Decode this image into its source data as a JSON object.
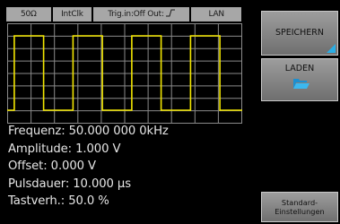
{
  "status_bar": {
    "impedance": "50Ω",
    "clock": "IntClk",
    "trigger": "Trig.in:Off Out:",
    "trigger_edge": "rising",
    "interface": "LAN"
  },
  "waveform": {
    "type": "pulse",
    "visible_cycles": 4,
    "color": "#f2e600"
  },
  "parameters": [
    {
      "label": "Frequenz:",
      "value": "50.000 000 0kHz"
    },
    {
      "label": "Amplitude:",
      "value": "1.000 V"
    },
    {
      "label": "Offset:",
      "value": "0.000 V"
    },
    {
      "label": "Pulsdauer:",
      "value": "10.000 µs"
    },
    {
      "label": "Tastverh.:",
      "value": "50.0 %"
    }
  ],
  "softkeys": {
    "save": "SPEICHERN",
    "load": "LADEN",
    "defaults_line1": "Standard-",
    "defaults_line2": "Einstellungen"
  },
  "colors": {
    "accent": "#29aee6",
    "trace": "#f2e600",
    "grid": "#8a8a8a",
    "text": "#e6e6e6"
  }
}
